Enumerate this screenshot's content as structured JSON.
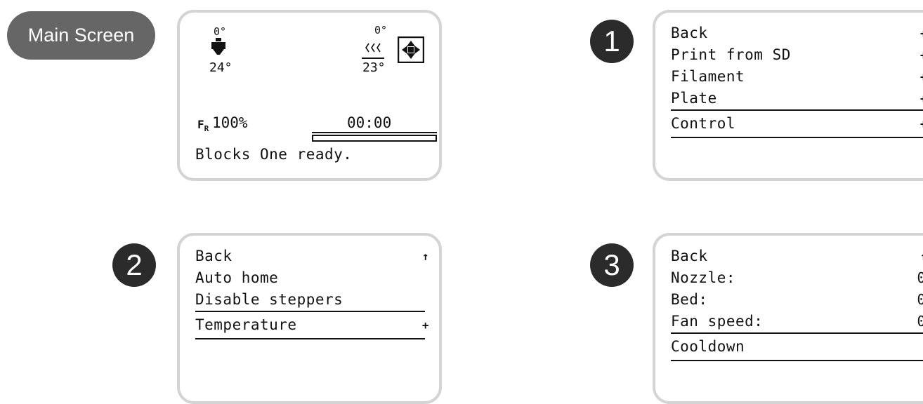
{
  "label": {
    "text": "Main Screen"
  },
  "main_screen": {
    "hotend_target": "0°",
    "hotend_current": "24°",
    "bed_target": "0°",
    "bed_current": "23°",
    "heat_glyph": "⌇⌇⌇",
    "home_icon": "home-arrows-icon",
    "feedrate_icon": "F",
    "feedrate_sub": "R",
    "feedrate": "100%",
    "elapsed_time": "00:00",
    "progress": 0,
    "status": "Blocks One ready."
  },
  "menus": [
    {
      "badge": "1",
      "items": [
        {
          "label": "Back",
          "trail": "+",
          "selected": false
        },
        {
          "label": "Print from SD",
          "trail": "+",
          "selected": false
        },
        {
          "label": "Filament",
          "trail": "+",
          "selected": false
        },
        {
          "label": "Plate",
          "trail": "+",
          "selected": false
        },
        {
          "label": "Control",
          "trail": "+",
          "selected": true
        }
      ]
    },
    {
      "badge": "2",
      "items": [
        {
          "label": "Back",
          "trail": "↑",
          "selected": false
        },
        {
          "label": "Auto home",
          "trail": "",
          "selected": false
        },
        {
          "label": "Disable steppers",
          "trail": "",
          "selected": false
        },
        {
          "label": "Temperature",
          "trail": "+",
          "selected": true
        }
      ]
    },
    {
      "badge": "3",
      "items": [
        {
          "label": "Back",
          "trail": "↑",
          "selected": false
        },
        {
          "label": "Nozzle:",
          "trail": "0",
          "selected": false
        },
        {
          "label": "Bed:",
          "trail": "0",
          "selected": false
        },
        {
          "label": "Fan speed:",
          "trail": "0",
          "selected": false
        },
        {
          "label": "Cooldown",
          "trail": "",
          "selected": true
        }
      ]
    }
  ],
  "colors": {
    "pill": "#666666",
    "badge": "#2b2b2b",
    "frame": "#d4d4d4",
    "ink": "#111111"
  }
}
